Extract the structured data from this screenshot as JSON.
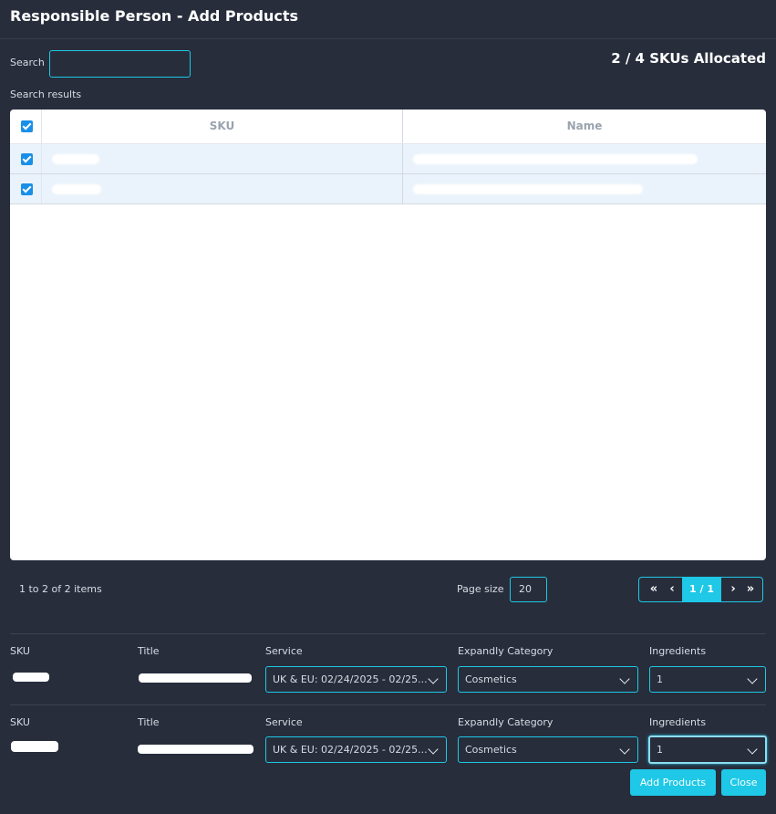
{
  "header": {
    "title": "Responsible Person - Add Products"
  },
  "search": {
    "label": "Search",
    "value": "",
    "placeholder": ""
  },
  "allocation": {
    "text": "2 / 4 SKUs Allocated"
  },
  "results": {
    "label": "Search results",
    "columns": {
      "sku": "SKU",
      "name": "Name"
    },
    "rows": [
      {
        "checked": true,
        "sku": "",
        "name": ""
      },
      {
        "checked": true,
        "sku": "",
        "name": ""
      }
    ]
  },
  "pagination": {
    "items_text": "1 to 2 of 2 items",
    "page_size_label": "Page size",
    "page_size_value": "20",
    "current": "1 / 1",
    "first": "«",
    "prev": "‹",
    "next": "›",
    "last": "»"
  },
  "products": {
    "labels": {
      "sku": "SKU",
      "title": "Title",
      "service": "Service",
      "category": "Expandly Category",
      "ingredients": "Ingredients"
    },
    "rows": [
      {
        "service": "UK & EU: 02/24/2025 - 02/25...",
        "category": "Cosmetics",
        "ingredients": "1"
      },
      {
        "service": "UK & EU: 02/24/2025 - 02/25...",
        "category": "Cosmetics",
        "ingredients": "1"
      }
    ]
  },
  "actions": {
    "add": "Add Products",
    "close": "Close"
  },
  "colors": {
    "background": "#272d3b",
    "accent": "#1ec8e6",
    "checkbox": "#1a8fe8"
  },
  "icons": {
    "checkbox": "check-icon",
    "dropdown": "chevron-down-icon"
  }
}
